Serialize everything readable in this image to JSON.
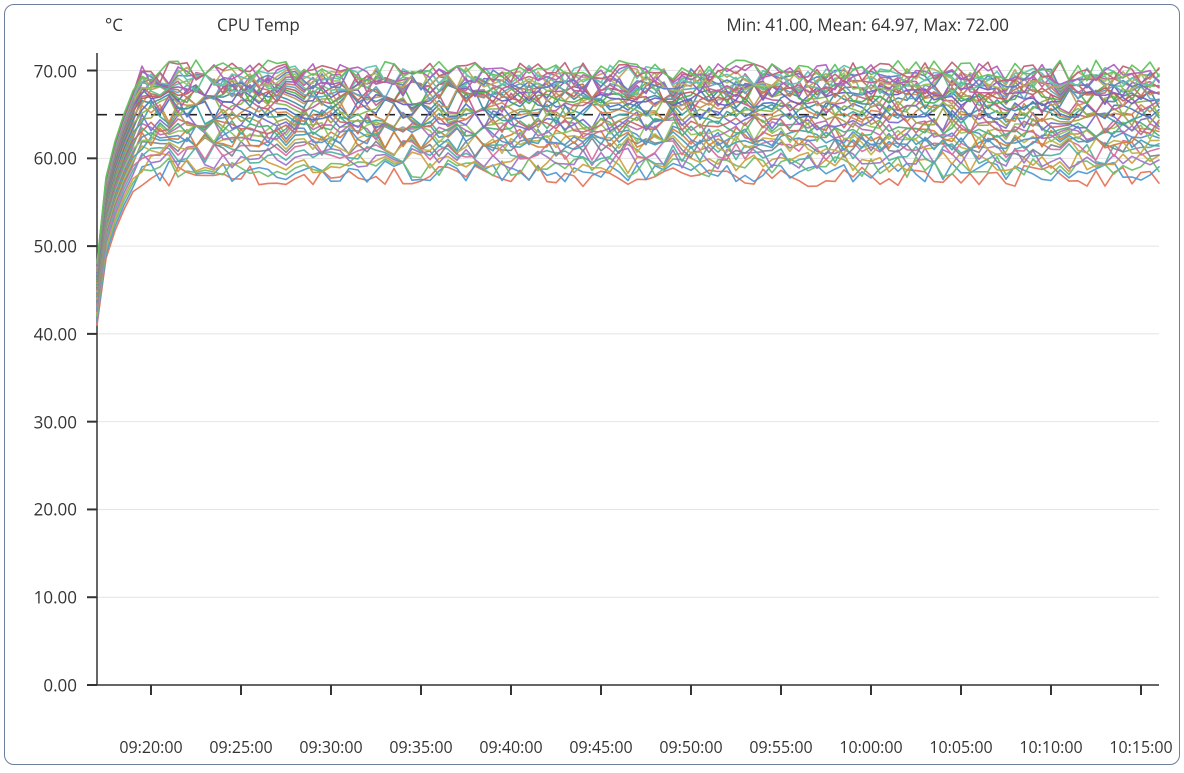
{
  "header": {
    "unit": "°C",
    "title": "CPU Temp",
    "stats": "Min: 41.00, Mean: 64.97, Max: 72.00"
  },
  "chart_data": {
    "type": "line",
    "ylabel": "°C",
    "title": "CPU Temp",
    "ylim": [
      0,
      72
    ],
    "y_ticks": [
      0.0,
      10.0,
      20.0,
      30.0,
      40.0,
      50.0,
      60.0,
      70.0
    ],
    "x_ticks": [
      "09:20:00",
      "09:25:00",
      "09:30:00",
      "09:35:00",
      "09:40:00",
      "09:45:00",
      "09:50:00",
      "09:55:00",
      "10:00:00",
      "10:05:00",
      "10:10:00",
      "10:15:00"
    ],
    "x_range_seconds": [
      0,
      3540
    ],
    "mean_line": 64.97,
    "stats": {
      "min": 41.0,
      "mean": 64.97,
      "max": 72.0
    },
    "n_series": 40,
    "series_colors": [
      "#e6745b",
      "#4f9ad6",
      "#6fbf6f",
      "#d1a23f",
      "#a076c8",
      "#51b3a3",
      "#d96fa1",
      "#7a8896",
      "#c2b24a",
      "#45a0b8",
      "#d87f3a",
      "#5b8fc9",
      "#95c45e",
      "#b96fb3",
      "#4fb27a",
      "#cc6a6a",
      "#7c6fd1",
      "#a3a34a",
      "#3fa3a3",
      "#d6894f",
      "#4f76c2",
      "#89b84f",
      "#c45e97",
      "#3f8fa3",
      "#c29a5b",
      "#6e5fc2",
      "#4fb24f",
      "#c25f5f",
      "#5fa3c2",
      "#c2765f",
      "#8f5fc2",
      "#5fc28f",
      "#c25f9a",
      "#9ac25f",
      "#5f7dc2",
      "#c2a35f",
      "#5fc2b2",
      "#b25fc2",
      "#c25f76",
      "#5fc25f"
    ],
    "series_steady_levels": [
      58.0,
      58.5,
      59.0,
      59.5,
      60.0,
      60.5,
      61.0,
      61.3,
      61.6,
      62.0,
      62.3,
      62.6,
      63.0,
      63.3,
      63.6,
      64.0,
      64.3,
      64.6,
      65.0,
      65.3,
      65.6,
      66.0,
      66.3,
      66.6,
      67.0,
      67.2,
      67.4,
      67.6,
      67.8,
      68.0,
      68.2,
      68.4,
      68.6,
      68.8,
      69.0,
      69.2,
      69.4,
      69.6,
      69.8,
      70.0
    ],
    "series_start_values": [
      41.0,
      41.5,
      42.0,
      42.3,
      42.6,
      43.0,
      43.3,
      43.6,
      44.0,
      44.2,
      44.4,
      44.6,
      44.8,
      45.0,
      45.1,
      45.2,
      45.3,
      45.4,
      45.6,
      45.8,
      46.0,
      46.1,
      46.2,
      46.3,
      46.4,
      46.5,
      46.6,
      46.7,
      46.8,
      46.9,
      47.0,
      47.1,
      47.2,
      47.3,
      47.4,
      47.5,
      47.6,
      47.7,
      47.8,
      48.0
    ],
    "noise_amplitude": 1.2,
    "warmup_samples": 5,
    "sample_step_seconds": 30
  }
}
